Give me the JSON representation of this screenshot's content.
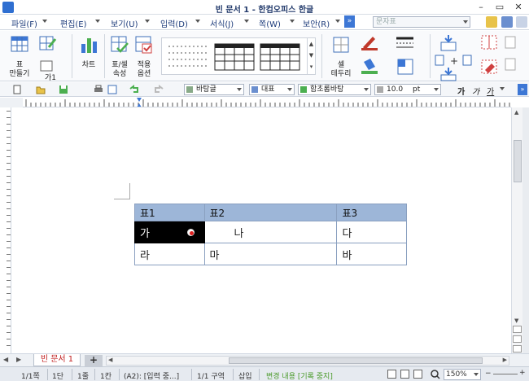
{
  "window": {
    "title": "빈 문서 1 - 한컴오피스 한글"
  },
  "menu": {
    "items": [
      "파일(F)",
      "편집(E)",
      "보기(U)",
      "입력(D)",
      "서식(J)",
      "쪽(W)",
      "보안(R)"
    ],
    "search_placeholder": "문자표"
  },
  "ribbon": {
    "make_table": "표\n만들기",
    "make_table_line1": "표",
    "make_table_line2": "만들기",
    "style_label": "가1",
    "chart": "차트",
    "cell_props_line1": "표/셀",
    "cell_props_line2": "속성",
    "apply_line1": "적용",
    "apply_line2": "옵션",
    "cell_border_line1": "셀",
    "cell_border_line2": "테두리"
  },
  "toolbar": {
    "style": "바탕글",
    "lang": "대표",
    "font": "함초롬바탕",
    "font_size": "10.0",
    "unit": "pt",
    "bold": "가",
    "italic": "가",
    "underline": "가"
  },
  "document": {
    "table": {
      "header": [
        "표1",
        "표2",
        "표3"
      ],
      "rows": [
        [
          "가",
          "나",
          "다"
        ],
        [
          "라",
          "마",
          "바"
        ]
      ]
    }
  },
  "tabs": {
    "doc_tab": "빈 문서 1",
    "add_tab": "+"
  },
  "status": {
    "page": "1/1쪽",
    "section": "1단",
    "line": "1줄",
    "column": "1칸",
    "cell": "(A2): [입력 중...]",
    "region": "1/1 구역",
    "mode": "삽입",
    "track": "변경 내용 [기록 중지]",
    "zoom": "150%"
  },
  "colors": {
    "accent": "#3d77d5",
    "menu_text": "#1b3a7a",
    "table_header": "#9db6d8",
    "selected_cell": "#000000",
    "track_text": "#4a9a2a",
    "tab_text": "#c02020"
  }
}
